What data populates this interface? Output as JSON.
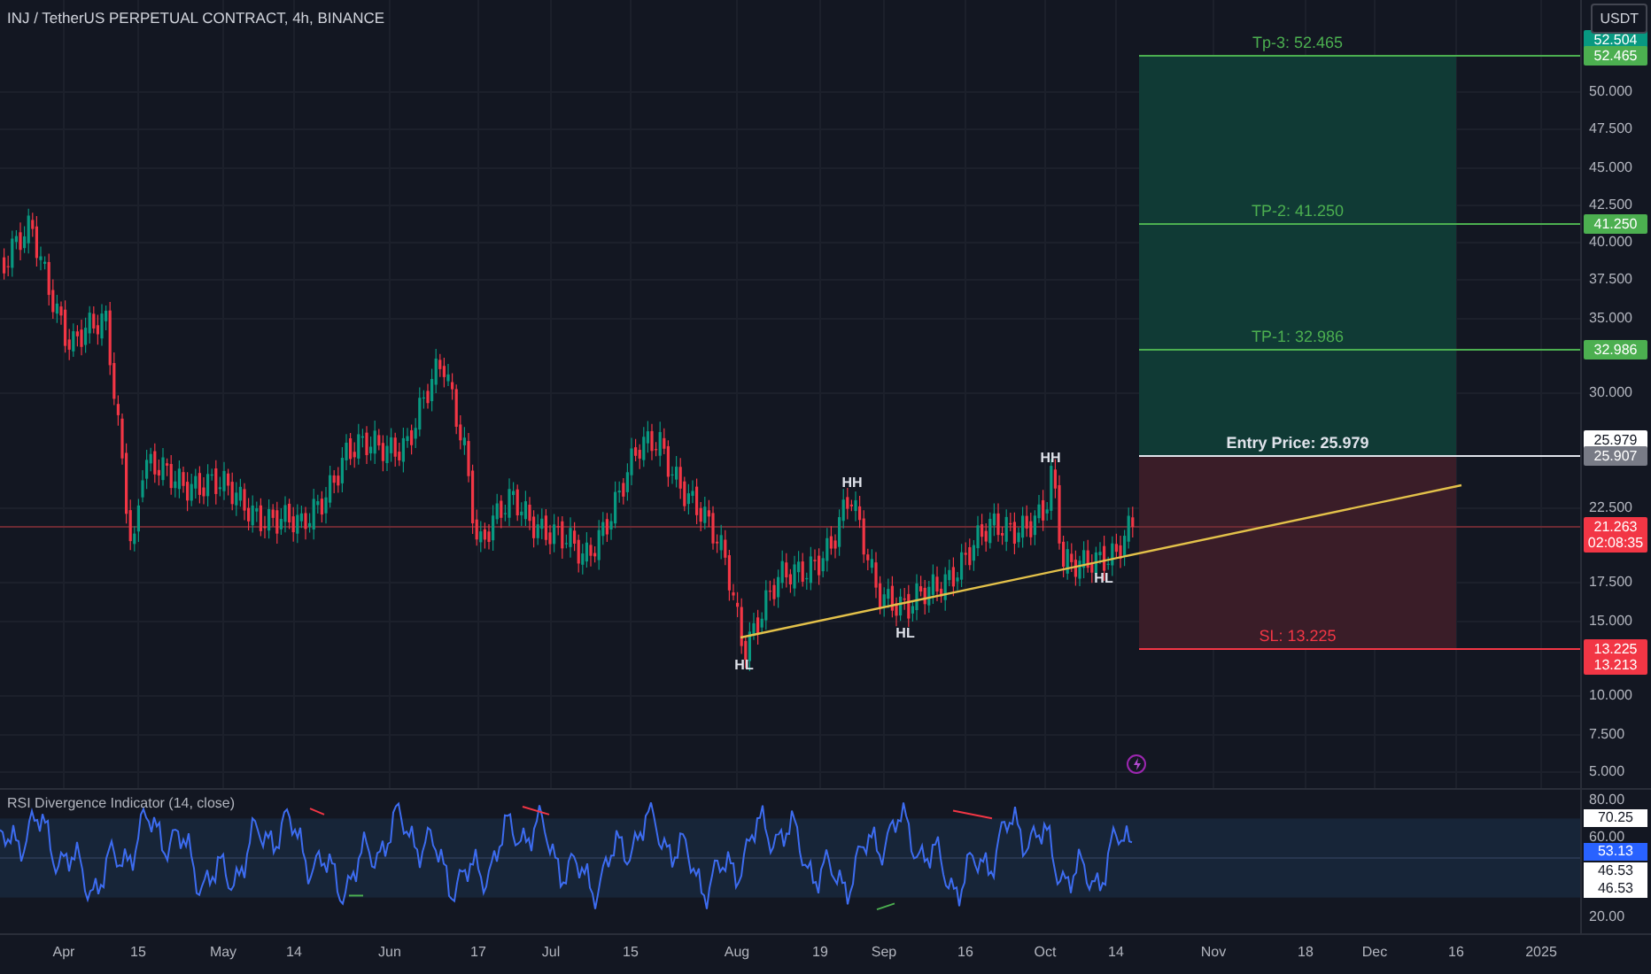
{
  "header": {
    "title": "INJ / TetherUS PERPETUAL CONTRACT, 4h, BINANCE",
    "currency_button": "USDT"
  },
  "levels": [
    {
      "kind": "target",
      "label": "Tp-3: 52.465"
    },
    {
      "kind": "target",
      "label": "TP-2: 41.250"
    },
    {
      "kind": "target",
      "label": "TP-1: 32.986"
    },
    {
      "kind": "entry",
      "label": "Entry Price: 25.979"
    },
    {
      "kind": "stop",
      "label": "SL: 13.225"
    }
  ],
  "pattern_labels": [
    "HH",
    "HH",
    "HL",
    "HL",
    "HL"
  ],
  "price_axis": {
    "ticks": [
      "50.000",
      "47.500",
      "45.000",
      "42.500",
      "40.000",
      "37.500",
      "35.000",
      "30.000",
      "22.500",
      "17.500",
      "15.000",
      "10.000",
      "7.500",
      "5.000"
    ],
    "badges": [
      {
        "text": "52.504",
        "color": "#089981"
      },
      {
        "text": "52.465",
        "color": "#4caf50"
      },
      {
        "text": "41.250",
        "color": "#4caf50"
      },
      {
        "text": "32.986",
        "color": "#4caf50"
      },
      {
        "text": "25.979",
        "color": "#ffffff"
      },
      {
        "text": "25.907",
        "color": "#787b86"
      },
      {
        "text": "21.263",
        "subtext": "02:08:35",
        "color": "#f23645"
      },
      {
        "text": "13.225",
        "color": "#f23645"
      },
      {
        "text": "13.213",
        "color": "#f23645"
      }
    ]
  },
  "rsi": {
    "title": "RSI Divergence Indicator (14, close)",
    "ticks": [
      "80.00",
      "60.00",
      "20.00"
    ],
    "badges": [
      {
        "text": "70.25",
        "color": "#ffffff"
      },
      {
        "text": "53.13",
        "color": "#2962ff"
      },
      {
        "text": "46.53",
        "color": "#ffffff"
      },
      {
        "text": "46.53",
        "color": "#ffffff"
      }
    ]
  },
  "time_axis": [
    "Apr",
    "15",
    "May",
    "14",
    "Jun",
    "17",
    "Jul",
    "15",
    "Aug",
    "19",
    "Sep",
    "16",
    "Oct",
    "14",
    "Nov",
    "18",
    "Dec",
    "16",
    "2025"
  ]
}
